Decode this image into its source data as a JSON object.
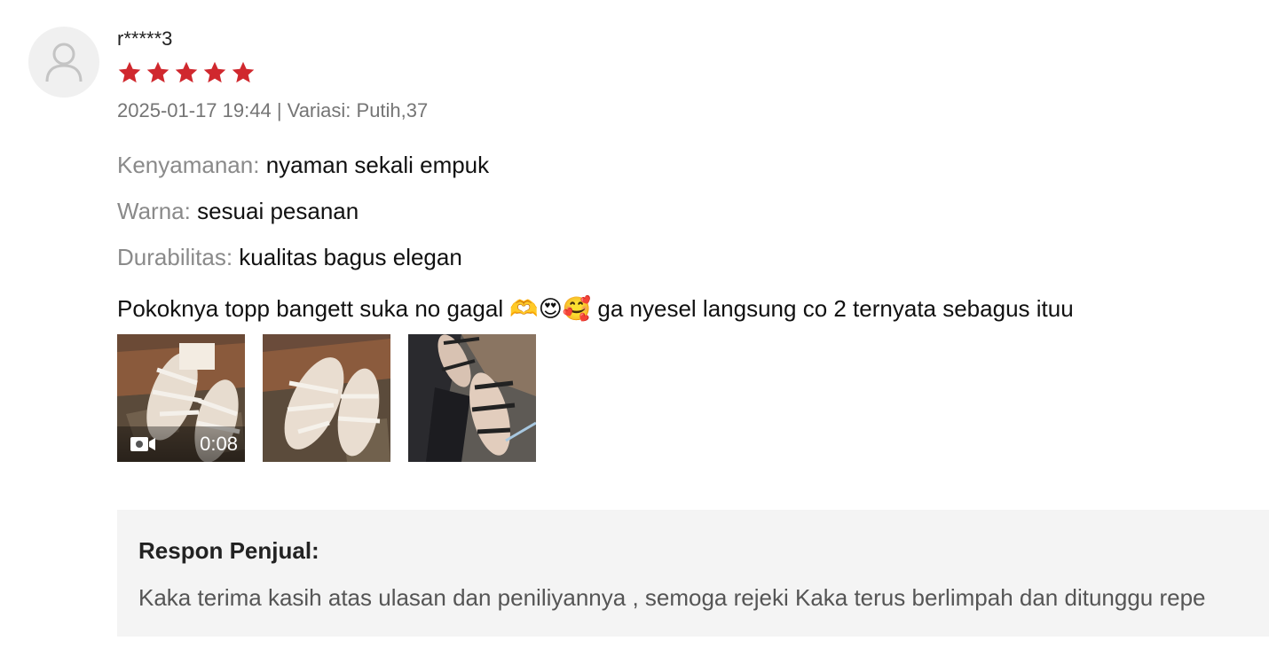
{
  "review": {
    "username": "r*****3",
    "rating": 5,
    "rating_max": 5,
    "star_color": "#d0282e",
    "datetime": "2025-01-17 19:44",
    "meta_separator": " | ",
    "variation_label": "Variasi:",
    "variation_value": "Putih,37",
    "attributes": [
      {
        "label": "Kenyamanan:",
        "value": "nyaman sekali empuk"
      },
      {
        "label": "Warna:",
        "value": "sesuai pesanan"
      },
      {
        "label": "Durabilitas:",
        "value": "kualitas bagus elegan"
      }
    ],
    "text": "Pokoknya topp bangett suka no gagal 🫶😍🥰 ga nyesel langsung co 2 ternyata sebagus ituu",
    "media": [
      {
        "type": "video",
        "duration": "0:08",
        "icon": "video-camera-icon"
      },
      {
        "type": "photo"
      },
      {
        "type": "photo"
      }
    ]
  },
  "seller_response": {
    "title": "Respon Penjual:",
    "text": "Kaka terima kasih atas ulasan dan peniliyannya , semoga rejeki Kaka terus berlimpah dan ditunggu repe"
  },
  "avatar": {
    "icon": "user-silhouette-icon"
  }
}
